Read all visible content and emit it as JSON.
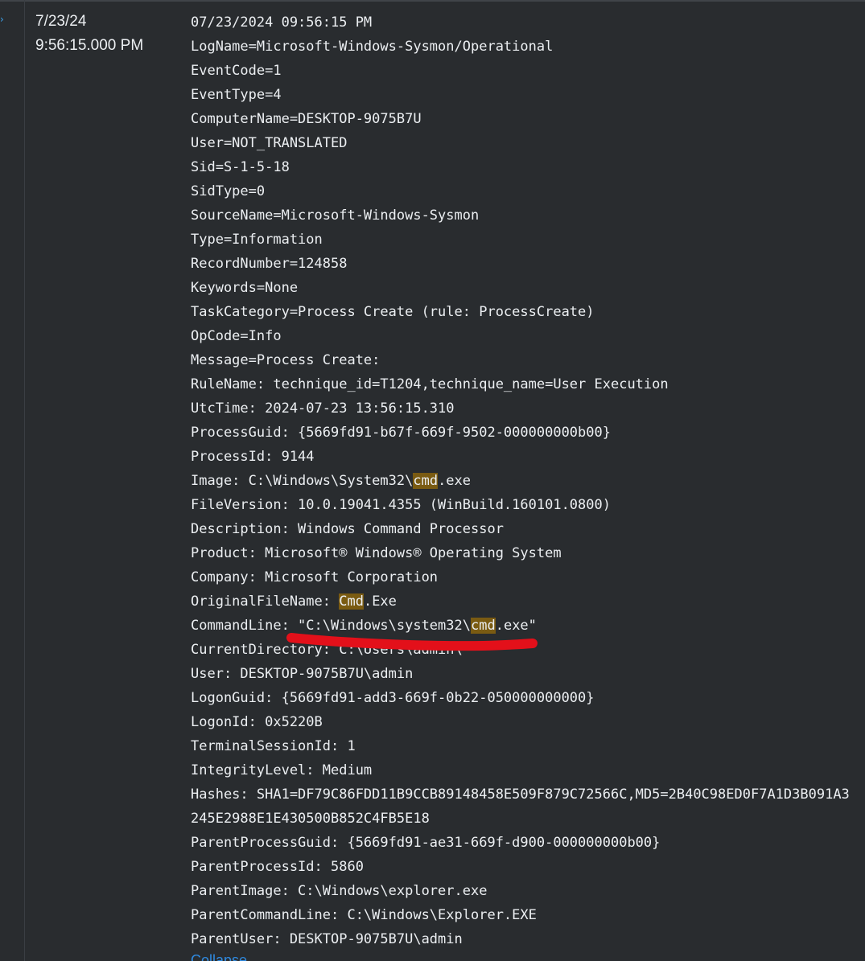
{
  "row": {
    "date": "7/23/24",
    "time": "9:56:15.000 PM",
    "collapse_label": "Collapse"
  },
  "event": {
    "lines": [
      {
        "text": "07/23/2024 09:56:15 PM"
      },
      {
        "text": "LogName=Microsoft-Windows-Sysmon/Operational"
      },
      {
        "text": "EventCode=1"
      },
      {
        "text": "EventType=4"
      },
      {
        "text": "ComputerName=DESKTOP-9075B7U"
      },
      {
        "text": "User=NOT_TRANSLATED"
      },
      {
        "text": "Sid=S-1-5-18"
      },
      {
        "text": "SidType=0"
      },
      {
        "text": "SourceName=Microsoft-Windows-Sysmon"
      },
      {
        "text": "Type=Information"
      },
      {
        "text": "RecordNumber=124858"
      },
      {
        "text": "Keywords=None"
      },
      {
        "text": "TaskCategory=Process Create (rule: ProcessCreate)"
      },
      {
        "text": "OpCode=Info"
      },
      {
        "text": "Message=Process Create:"
      },
      {
        "text": "RuleName: technique_id=T1204,technique_name=User Execution"
      },
      {
        "text": "UtcTime: 2024-07-23 13:56:15.310"
      },
      {
        "text": "ProcessGuid: {5669fd91-b67f-669f-9502-000000000b00}"
      },
      {
        "text": "ProcessId: 9144"
      },
      {
        "pre": "Image: C:\\Windows\\System32\\",
        "hl": "cmd",
        "post": ".exe"
      },
      {
        "text": "FileVersion: 10.0.19041.4355 (WinBuild.160101.0800)"
      },
      {
        "text": "Description: Windows Command Processor"
      },
      {
        "text": "Product: Microsoft® Windows® Operating System"
      },
      {
        "text": "Company: Microsoft Corporation"
      },
      {
        "pre": "OriginalFileName: ",
        "hl": "Cmd",
        "post": ".Exe"
      },
      {
        "pre": "CommandLine: \"C:\\Windows\\system32\\",
        "hl": "cmd",
        "post": ".exe\""
      },
      {
        "text": "CurrentDirectory: C:\\Users\\admin\\"
      },
      {
        "text": "User: DESKTOP-9075B7U\\admin"
      },
      {
        "text": "LogonGuid: {5669fd91-add3-669f-0b22-050000000000}"
      },
      {
        "text": "LogonId: 0x5220B"
      },
      {
        "text": "TerminalSessionId: 1"
      },
      {
        "text": "IntegrityLevel: Medium"
      },
      {
        "text": "Hashes: SHA1=DF79C86FDD11B9CCB89148458E509F879C72566C,MD5=2B40C98ED0F7A1D3B091A3"
      },
      {
        "text": "245E2988E1E430500B852C4FB5E18"
      },
      {
        "text": "ParentProcessGuid: {5669fd91-ae31-669f-d900-000000000b00}"
      },
      {
        "text": "ParentProcessId: 5860"
      },
      {
        "text": "ParentImage: C:\\Windows\\explorer.exe"
      },
      {
        "text": "ParentCommandLine: C:\\Windows\\Explorer.EXE"
      },
      {
        "text": "ParentUser: DESKTOP-9075B7U\\admin"
      }
    ]
  },
  "colors": {
    "background": "#292c2f",
    "text": "#ebeef1",
    "highlight": "#7a5b12",
    "link": "#2f8ae0",
    "annotation": "#e3101a"
  },
  "icons": {
    "expand": "chevron-right-icon"
  }
}
